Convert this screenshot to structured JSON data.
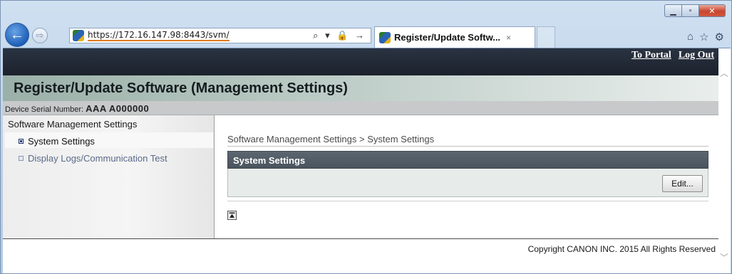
{
  "browser": {
    "url": "https://172.16.147.98:8443/svm/",
    "tab_title": "Register/Update Softw...",
    "back_glyph": "←",
    "forward_glyph": "⇨",
    "addr_tools": "⌕ ▾ 🔒 →",
    "tab_close": "×",
    "minimize": "▁",
    "maximize": "▫",
    "close": "✕",
    "home": "⌂",
    "favorites": "☆",
    "settings": "⚙"
  },
  "header": {
    "to_portal": "To Portal",
    "log_out": "Log Out",
    "title": "Register/Update Software (Management Settings)"
  },
  "device": {
    "serial_label": "Device Serial Number: ",
    "serial_value": "AAA A000000"
  },
  "sidebar": {
    "heading": "Software Management Settings",
    "items": [
      {
        "label": "System Settings",
        "active": true
      },
      {
        "label": "Display Logs/Communication Test",
        "active": false
      }
    ]
  },
  "main": {
    "breadcrumb": "Software Management Settings > System Settings",
    "panel_title": "System Settings",
    "edit_label": "Edit..."
  },
  "footer": {
    "copyright": "Copyright CANON INC. 2015 All Rights Reserved"
  },
  "colors": {
    "accent_underline": "#e07a1f",
    "panel_header": "#4f5a63",
    "top_strip": "#1f2530"
  }
}
